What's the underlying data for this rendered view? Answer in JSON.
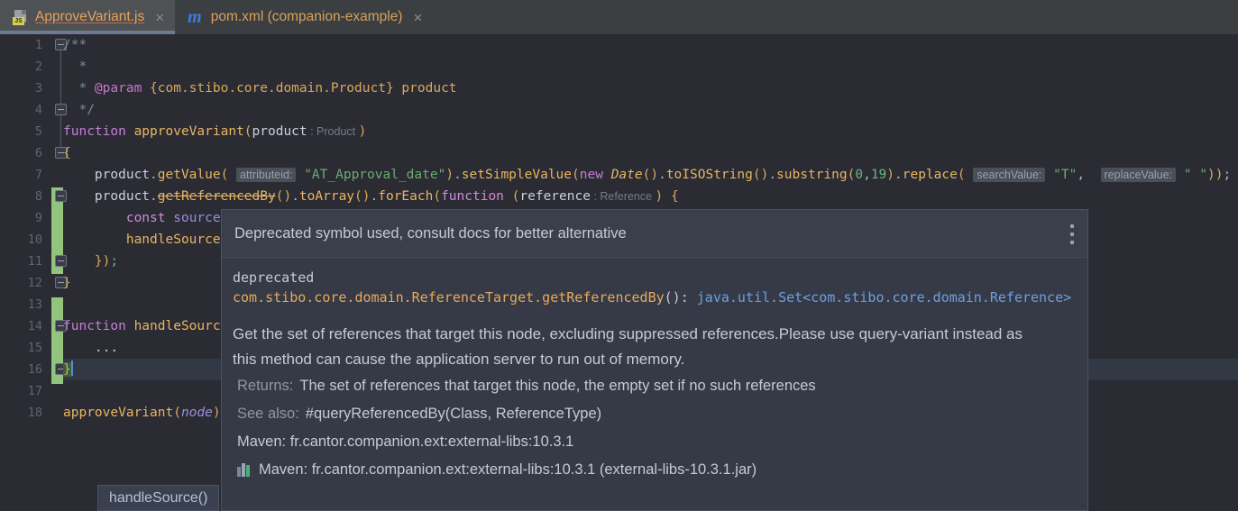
{
  "tabs": [
    {
      "label": "ApproveVariant.js",
      "icon": "js-file-icon",
      "close": "×",
      "active": true
    },
    {
      "label": "pom.xml (companion-example)",
      "icon": "maven-icon",
      "close": "×",
      "active": false
    }
  ],
  "editor": {
    "line_numbers": [
      "1",
      "2",
      "3",
      "4",
      "5",
      "6",
      "7",
      "8",
      "9",
      "10",
      "11",
      "12",
      "13",
      "14",
      "15",
      "16",
      "17",
      "18"
    ],
    "lines": [
      {
        "n": 1,
        "text": "/**"
      },
      {
        "n": 2,
        "text": " *"
      },
      {
        "n": 3,
        "text": " * @param {com.stibo.core.domain.Product} product"
      },
      {
        "n": 4,
        "text": " */"
      },
      {
        "n": 5,
        "text": "function approveVariant(product : Product )"
      },
      {
        "n": 6,
        "text": "{"
      },
      {
        "n": 7,
        "text": "    product.getValue( attributeid: \"AT_Approval_date\").setSimpleValue(new Date().toISOString().substring(0,19).replace( searchValue: \"T\",  replaceValue: \" \"));"
      },
      {
        "n": 8,
        "text": "    product.getReferencedBy().toArray().forEach(function (reference : Reference ) {"
      },
      {
        "n": 9,
        "text": "        const source"
      },
      {
        "n": 10,
        "text": "        handleSource("
      },
      {
        "n": 11,
        "text": "    });"
      },
      {
        "n": 12,
        "text": "}"
      },
      {
        "n": 13,
        "text": ""
      },
      {
        "n": 14,
        "text": "function handleSource"
      },
      {
        "n": 15,
        "text": "    ..."
      },
      {
        "n": 16,
        "text": "}"
      },
      {
        "n": 17,
        "text": ""
      },
      {
        "n": 18,
        "text": "approveVariant(node);"
      }
    ],
    "inlay_hints": [
      "attributeid:",
      "searchValue:",
      "replaceValue:"
    ],
    "type_hints": [
      ": Product",
      ": Reference"
    ],
    "current_line": "16"
  },
  "popup": {
    "title": "Deprecated symbol used, consult docs for better alternative",
    "menu_icon": "vertical-dots-icon",
    "deprecated_label": "deprecated",
    "signature": {
      "qualified_name": "com.stibo.core.domain.ReferenceTarget.getReferencedBy",
      "parens": "():",
      "return_type": "java.util.Set<com.stibo.core.domain.Reference>"
    },
    "description": "Get the set of references that target this node, excluding suppressed references.Please use query-variant instead as this method can cause the application server to run out of memory.",
    "returns_label": "Returns:",
    "returns_value": "The set of references that target this node, the empty set if no such references",
    "see_also_label": "See also:",
    "see_also_value": "#queryReferencedBy(Class, ReferenceType)",
    "maven_line_1": "Maven: fr.cantor.companion.ext:external-libs:10.3.1",
    "maven_line_2": "Maven: fr.cantor.companion.ext:external-libs:10.3.1 (external-libs-10.3.1.jar)",
    "jar_icon": "jar-library-icon"
  },
  "param_tooltip": {
    "text": "handleSource()"
  },
  "colors": {
    "editor_bg": "#2b2b33",
    "tabbar_bg": "#3c3f41",
    "popup_bg": "#353a46",
    "popup_header_bg": "#3a3f4b",
    "change_marker": "#93c47d",
    "accent_string": "#6aab73",
    "accent_keyword": "#c27fd6",
    "accent_function": "#e8b563",
    "accent_type": "#6f9fe0"
  }
}
